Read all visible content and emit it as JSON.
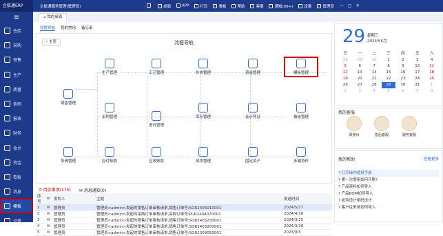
{
  "app": {
    "logo": "企航通ERP",
    "title": "企航通服务管理(管理员)"
  },
  "toolbar": [
    {
      "label": "",
      "icon": "cart-icon"
    },
    {
      "label": "桌面",
      "icon": "desktop-icon"
    },
    {
      "label": "APP",
      "icon": "phone-icon"
    },
    {
      "label": "打印",
      "icon": "print-icon"
    },
    {
      "label": "看板",
      "icon": "board-icon"
    },
    {
      "label": "帮助",
      "icon": "help-icon"
    },
    {
      "label": "客服",
      "icon": "service-icon"
    },
    {
      "label": "通知(99+)",
      "icon": "bell-icon"
    },
    {
      "label": "设置",
      "icon": "gear-icon"
    },
    {
      "label": "管理员",
      "icon": "user-icon"
    }
  ],
  "tab": {
    "label": "我的桌面"
  },
  "sidebar": [
    {
      "label": "仓库",
      "icon": "warehouse-icon"
    },
    {
      "label": "采购",
      "icon": "cart-icon"
    },
    {
      "label": "销售",
      "icon": "sales-icon"
    },
    {
      "label": "生产",
      "icon": "factory-icon"
    },
    {
      "label": "质量",
      "icon": "shield-icon"
    },
    {
      "label": "条码",
      "icon": "barcode-icon"
    },
    {
      "label": "报表",
      "icon": "report-icon"
    },
    {
      "label": "财务",
      "icon": "finance-icon"
    },
    {
      "label": "会计",
      "icon": "accounting-icon"
    },
    {
      "label": "资金",
      "icon": "money-icon"
    },
    {
      "label": "看板",
      "icon": "board-icon"
    },
    {
      "label": "消息",
      "icon": "message-icon"
    },
    {
      "label": "模板",
      "icon": "template-icon"
    },
    {
      "label": "设置",
      "icon": "gear-icon"
    }
  ],
  "subtabs": [
    "流程导航",
    "我的常用",
    "备忘录"
  ],
  "flow": {
    "title": "流程导航",
    "home": "主页",
    "nodes": {
      "sales": "销售管理",
      "production": "生产管理",
      "craft": "工艺管理",
      "outsource": "外协管理",
      "funds": "资金管理",
      "template": "模板管理",
      "purchase": "采购管理",
      "stock": "库存管理",
      "accounting": "会计凭证",
      "board": "看板管理",
      "inbound": "进行管理",
      "system": "系统管理",
      "payable": "应付账款",
      "receivable": "应收账款",
      "cost": "成本管理",
      "assets": "固定资产",
      "collab": "多端协作"
    }
  },
  "todo": {
    "tab_todo": "待办事项(175)",
    "tab_msg": "消息通知(0)",
    "headers": [
      "序号",
      "发件人",
      "主题",
      "发送时间"
    ],
    "rows": [
      {
        "no": "1",
        "sender": "管理员",
        "subject": "管理员<admin>发起的销售订单审核请求,销售订单号:SOR2405010001",
        "time": "2024/5/17"
      },
      {
        "no": "2",
        "sender": "管理员",
        "subject": "管理员<admin>发起的采购订单审核请求,采购订单号:PUR2404070001",
        "time": "2024/4/16"
      },
      {
        "no": "3",
        "sender": "管理员",
        "subject": "管理员<admin>发起的销售订单审核请求,销售订单号:SOR2403250001",
        "time": "2024/3/25"
      },
      {
        "no": "4",
        "sender": "管理员",
        "subject": "管理员<admin>发起的销售订单审核请求,销售订单号:SOR2403200001",
        "time": "2024/3/20"
      },
      {
        "no": "5",
        "sender": "管理员",
        "subject": "管理员<admin>发起的销售订单审核请求,销售订单号:SOR2309050001",
        "time": "2023/9/5"
      }
    ]
  },
  "calendar": {
    "day": "29",
    "weekday": "星期三",
    "year_month": "2024年5月",
    "weekdays": [
      "日",
      "一",
      "二",
      "三",
      "四",
      "五",
      "六"
    ],
    "weeks": [
      [
        "28",
        "29",
        "30",
        "1",
        "2",
        "3",
        "4"
      ],
      [
        "5",
        "6",
        "7",
        "8",
        "9",
        "10",
        "11"
      ],
      [
        "12",
        "13",
        "14",
        "15",
        "16",
        "17",
        "18"
      ],
      [
        "19",
        "20",
        "21",
        "22",
        "23",
        "24",
        "25"
      ],
      [
        "26",
        "27",
        "28",
        "29",
        "30",
        "31",
        "1"
      ],
      [
        "2",
        "3",
        "4",
        "5",
        "6",
        "7",
        "8"
      ]
    ]
  },
  "service": {
    "title": "我的客服",
    "agents": [
      "周朋州",
      "售后客服",
      "服务客服"
    ]
  },
  "help": {
    "title": "我的帮助",
    "more": "查看更多",
    "items": [
      "打开操作使用手册",
      "第一次使用如何开账?",
      "产品资料如何导入",
      "产品BOM如何导入",
      "如何设计条码设计",
      "客户往来单如何导入"
    ]
  }
}
